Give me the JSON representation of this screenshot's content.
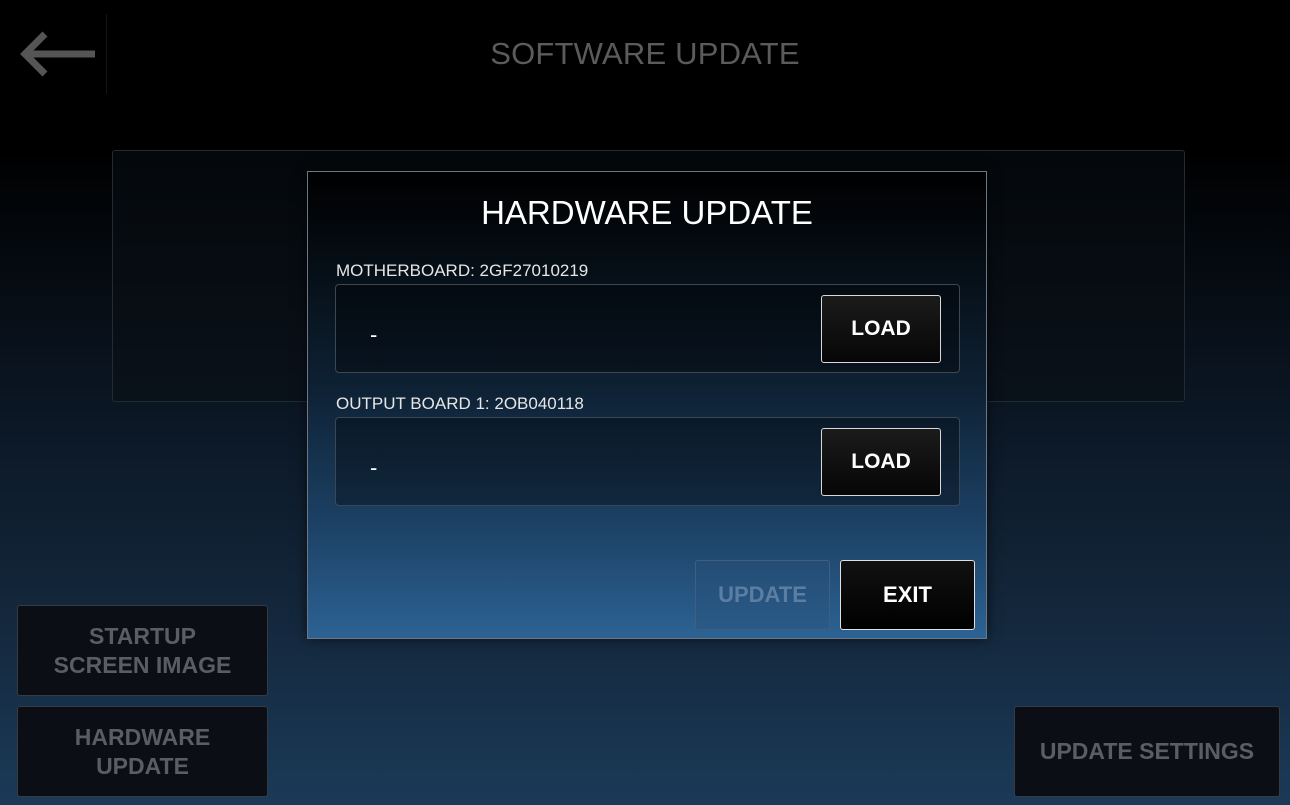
{
  "header": {
    "title": "SOFTWARE UPDATE",
    "back_icon": "arrow-left-icon"
  },
  "sidebar": {
    "startup_label": "STARTUP SCREEN IMAGE",
    "hardware_label": "HARDWARE UPDATE"
  },
  "footer": {
    "update_settings_label": "UPDATE SETTINGS"
  },
  "modal": {
    "title": "HARDWARE UPDATE",
    "motherboard": {
      "label": "MOTHERBOARD: 2GF27010219",
      "value": "-",
      "load_label": "LOAD"
    },
    "output_board": {
      "label": "OUTPUT BOARD 1: 2OB040118",
      "value": "-",
      "load_label": "LOAD"
    },
    "update_label": "UPDATE",
    "exit_label": "EXIT"
  },
  "colors": {
    "background": "#000000",
    "modal_bottom": "#2d6394",
    "disabled_text": "#5b7fa3",
    "dimmed_text": "#5a5e64"
  }
}
